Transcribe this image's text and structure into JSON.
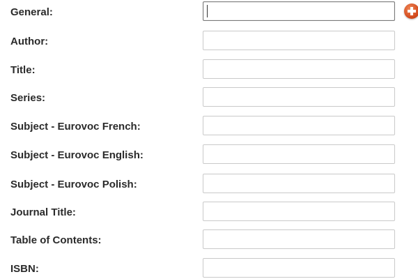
{
  "form": {
    "fields": [
      {
        "id": "general",
        "label": "General:",
        "value": ""
      },
      {
        "id": "author",
        "label": "Author:",
        "value": ""
      },
      {
        "id": "title",
        "label": "Title:",
        "value": ""
      },
      {
        "id": "series",
        "label": "Series:",
        "value": ""
      },
      {
        "id": "subject-eurovoc-french",
        "label": "Subject - Eurovoc French:",
        "value": ""
      },
      {
        "id": "subject-eurovoc-english",
        "label": "Subject - Eurovoc English:",
        "value": ""
      },
      {
        "id": "subject-eurovoc-polish",
        "label": "Subject - Eurovoc Polish:",
        "value": ""
      },
      {
        "id": "journal-title",
        "label": "Journal Title:",
        "value": ""
      },
      {
        "id": "table-of-contents",
        "label": "Table of Contents:",
        "value": ""
      },
      {
        "id": "isbn",
        "label": "ISBN:",
        "value": ""
      }
    ],
    "add_button_icon": "plus-circle-icon",
    "add_button_color": "#d2491c"
  }
}
